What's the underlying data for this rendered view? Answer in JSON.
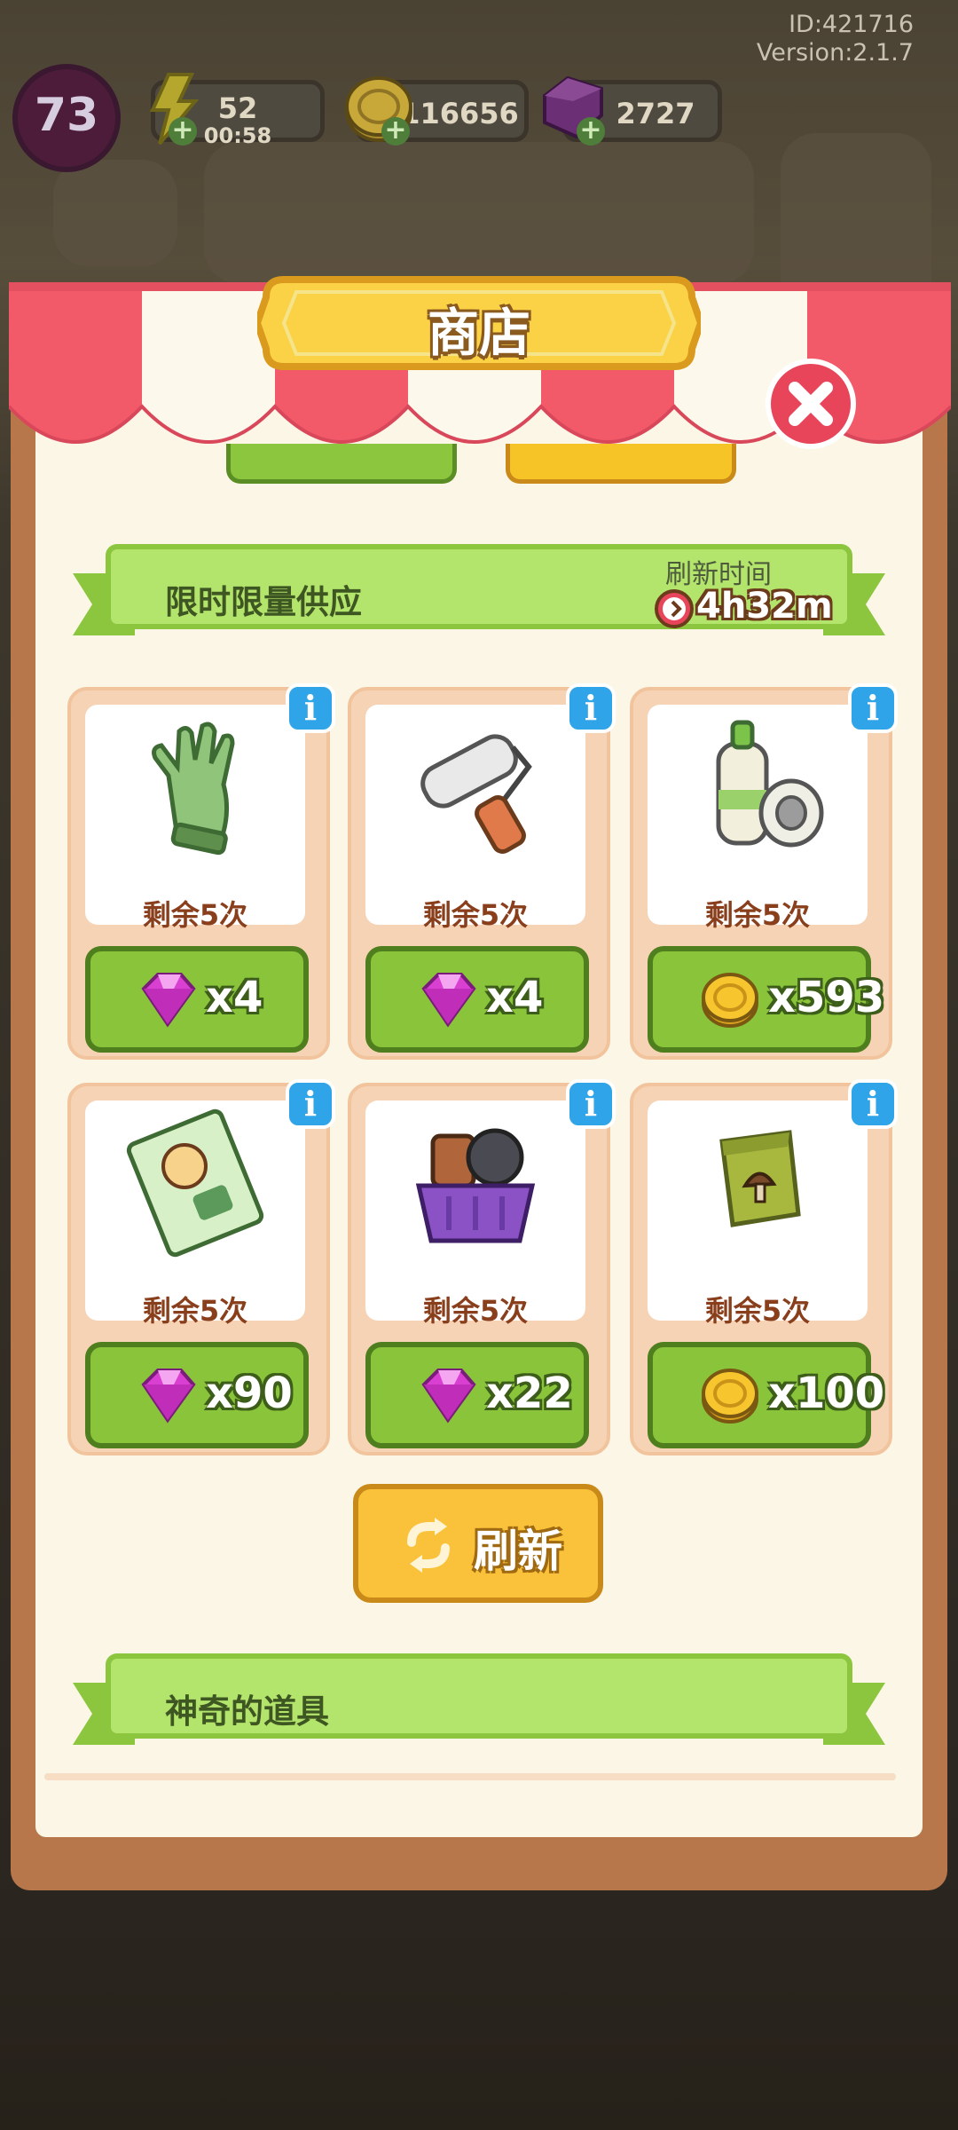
{
  "meta": {
    "id": "ID:421716",
    "version": "Version:2.1.7"
  },
  "hud": {
    "level": "73",
    "energy": {
      "value": "52",
      "timer": "00:58",
      "icon": "lightning-icon"
    },
    "coins": {
      "value": "116656",
      "icon": "coin-icon"
    },
    "gems": {
      "value": "2727",
      "icon": "gem-icon"
    }
  },
  "shop": {
    "title": "商店",
    "section_limited": {
      "title": "限时限量供应",
      "refresh_label": "刷新时间",
      "refresh_timer": "4h32m"
    },
    "items": [
      {
        "name": "gloves",
        "remaining": "剩余5次",
        "currency": "gem",
        "price": "x4"
      },
      {
        "name": "paint-roller",
        "remaining": "剩余5次",
        "currency": "gem",
        "price": "x4"
      },
      {
        "name": "spray-bottle-and-tape",
        "remaining": "剩余5次",
        "currency": "coin",
        "price": "x593"
      },
      {
        "name": "seed-packet",
        "remaining": "剩余5次",
        "currency": "gem",
        "price": "x90"
      },
      {
        "name": "basket-of-tools",
        "remaining": "剩余5次",
        "currency": "gem",
        "price": "x22"
      },
      {
        "name": "mushroom-seed-bag",
        "remaining": "剩余5次",
        "currency": "coin",
        "price": "x100"
      }
    ],
    "refresh_button": "刷新",
    "section_magic": {
      "title": "神奇的道具"
    }
  },
  "colors": {
    "awning_red": "#f25a6a",
    "green_button": "#8ac43a",
    "gold": "#f9c23a",
    "panel_brown": "#b8774a"
  }
}
